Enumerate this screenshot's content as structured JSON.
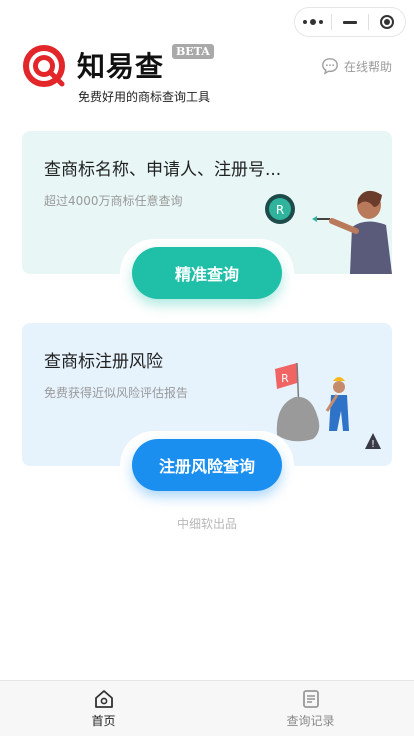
{
  "app": {
    "title": "知易查",
    "badge": "BETA",
    "subtitle": "免费好用的商标查询工具"
  },
  "header": {
    "help_label": "在线帮助"
  },
  "cards": [
    {
      "title": "查商标名称、申请人、注册号...",
      "desc": "超过4000万商标任意查询",
      "button": "精准查询"
    },
    {
      "title": "查商标注册风险",
      "desc": "免费获得近似风险评估报告",
      "button": "注册风险查询"
    }
  ],
  "footer": {
    "text": "中细软出品"
  },
  "tabbar": {
    "items": [
      {
        "label": "首页",
        "icon": "home-icon",
        "active": true
      },
      {
        "label": "查询记录",
        "icon": "history-icon",
        "active": false
      }
    ]
  },
  "colors": {
    "brand_red": "#e2262a",
    "teal": "#1fbfa8",
    "blue": "#1a8ff0"
  }
}
